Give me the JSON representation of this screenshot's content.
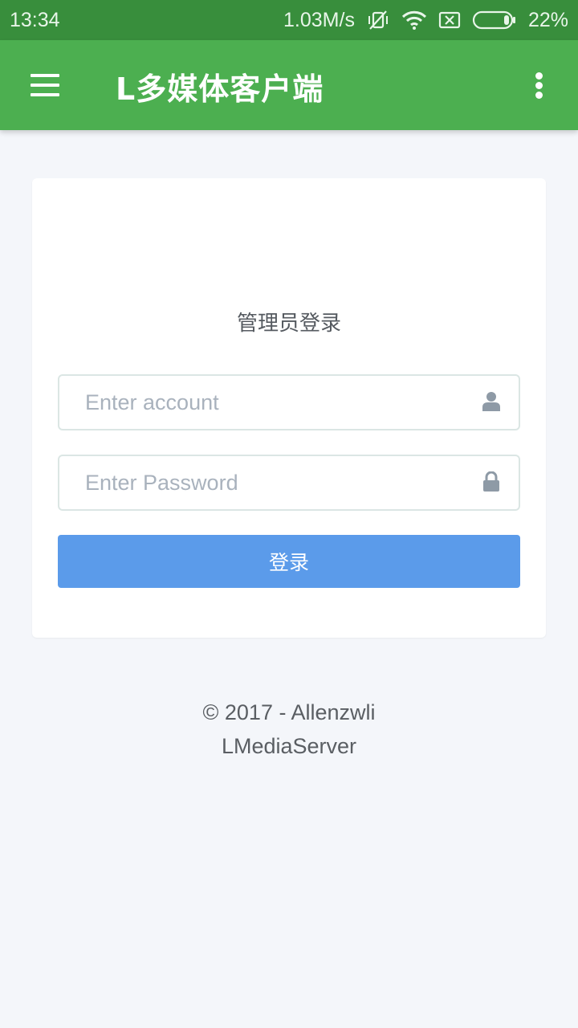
{
  "status_bar": {
    "time": "13:34",
    "network_speed": "1.03M/s",
    "battery_percent": "22%",
    "icons": [
      "vibrate-off-icon",
      "wifi-icon",
      "no-sim-icon",
      "battery-icon"
    ]
  },
  "app_bar": {
    "title": "L多媒体客户端",
    "background": "#4caf50",
    "icons": [
      "menu-icon",
      "more-vert-icon"
    ]
  },
  "login_card": {
    "title": "管理员登录",
    "account": {
      "placeholder": "Enter account",
      "value": "",
      "icon": "user-icon"
    },
    "password": {
      "placeholder": "Enter Password",
      "value": "",
      "icon": "lock-icon"
    },
    "submit_label": "登录",
    "submit_color": "#5b9bea"
  },
  "footer": {
    "copyright": "© 2017 - Allenzwli",
    "app_name": "LMediaServer"
  }
}
